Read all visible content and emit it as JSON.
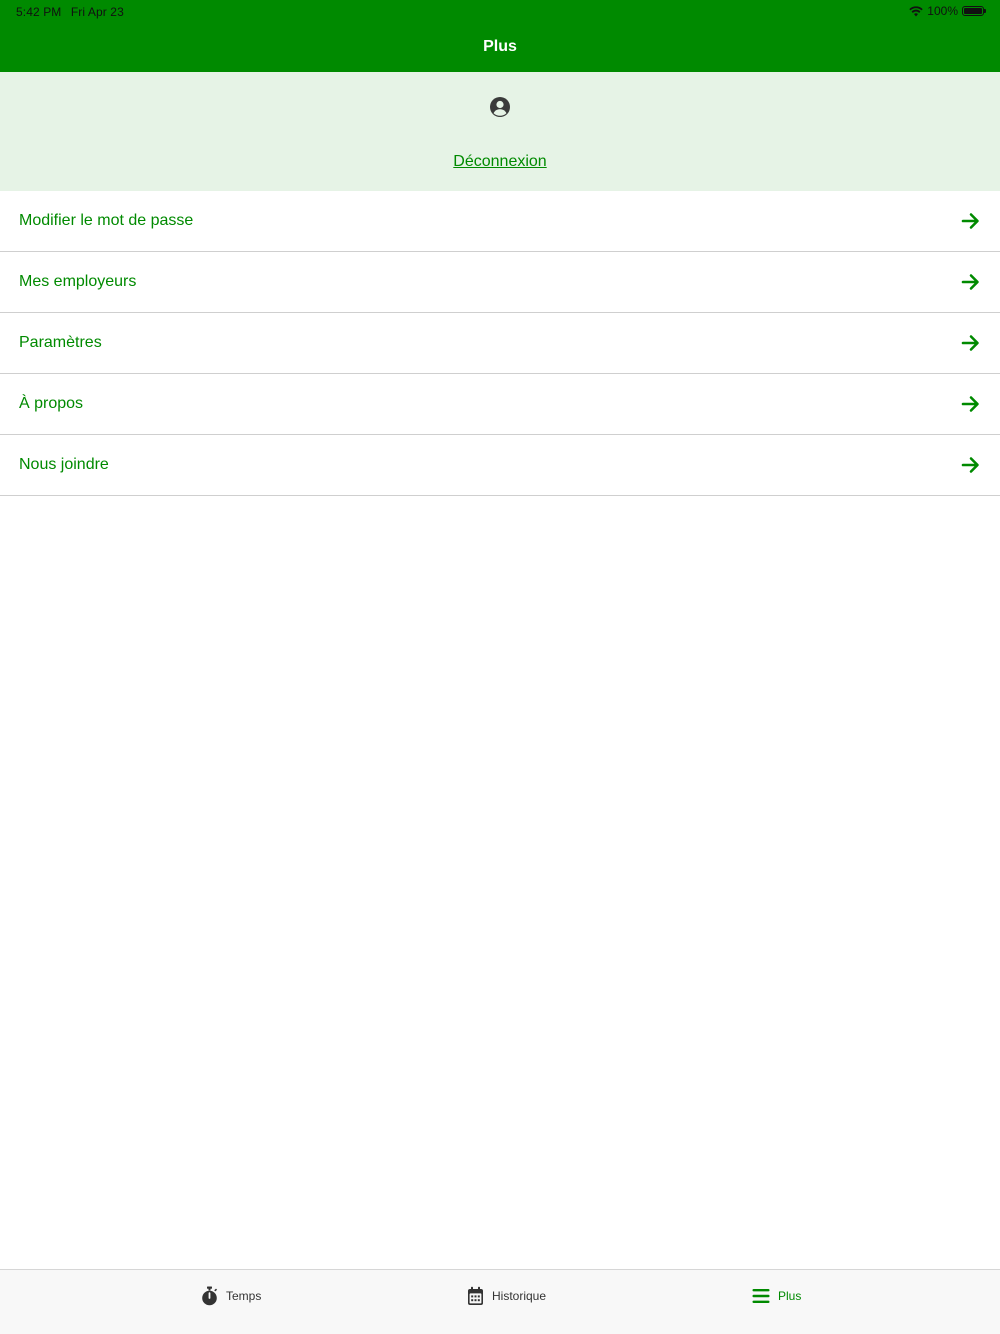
{
  "status_bar": {
    "time": "5:42 PM",
    "date": "Fri Apr 23",
    "battery": "100%",
    "battery_level": 1.0
  },
  "header": {
    "title": "Plus"
  },
  "profile": {
    "avatar_icon": "user-circle-icon",
    "logout_label": "Déconnexion"
  },
  "menu": {
    "items": [
      {
        "label": "Modifier le mot de passe",
        "icon": "arrow-right-icon"
      },
      {
        "label": "Mes employeurs",
        "icon": "arrow-right-icon"
      },
      {
        "label": "Paramètres",
        "icon": "arrow-right-icon"
      },
      {
        "label": "À propos",
        "icon": "arrow-right-icon"
      },
      {
        "label": "Nous joindre",
        "icon": "arrow-right-icon"
      }
    ]
  },
  "tabbar": {
    "tabs": [
      {
        "label": "Temps",
        "icon": "stopwatch-icon",
        "active": false
      },
      {
        "label": "Historique",
        "icon": "calendar-icon",
        "active": false
      },
      {
        "label": "Plus",
        "icon": "menu-icon",
        "active": true
      }
    ]
  },
  "colors": {
    "brand_green": "#008a00",
    "profile_bg": "#e6f3e6",
    "divider": "#cfcfcf",
    "tabbar_bg": "#f8f8f8",
    "inactive_icon": "#333333"
  }
}
